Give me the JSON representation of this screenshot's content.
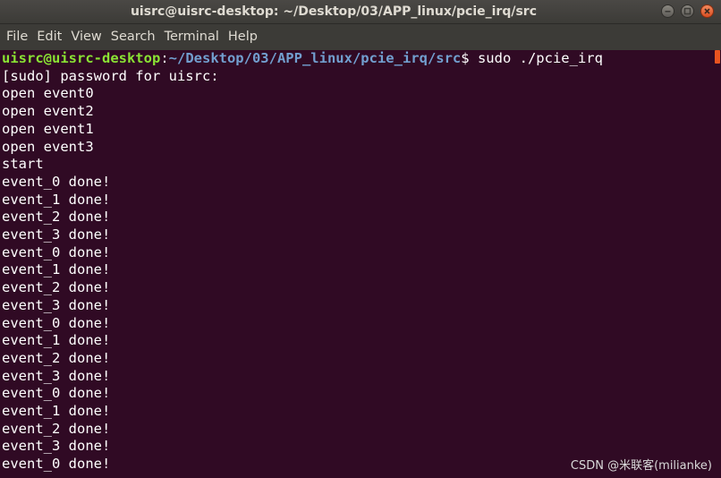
{
  "window": {
    "title": "uisrc@uisrc-desktop: ~/Desktop/03/APP_linux/pcie_irq/src"
  },
  "menu": [
    "File",
    "Edit",
    "View",
    "Search",
    "Terminal",
    "Help"
  ],
  "prompt": {
    "user_host": "uisrc@uisrc-desktop",
    "separator": ":",
    "path": "~/Desktop/03/APP_linux/pcie_irq/src",
    "symbol": "$",
    "command": " sudo ./pcie_irq"
  },
  "output_lines": [
    "[sudo] password for uisrc:",
    "open event0",
    "open event2",
    "open event1",
    "open event3",
    "start",
    "event_0 done!",
    "event_1 done!",
    "event_2 done!",
    "event_3 done!",
    "event_0 done!",
    "event_1 done!",
    "event_2 done!",
    "event_3 done!",
    "event_0 done!",
    "event_1 done!",
    "event_2 done!",
    "event_3 done!",
    "event_0 done!",
    "event_1 done!",
    "event_2 done!",
    "event_3 done!",
    "event_0 done!"
  ],
  "watermark": "CSDN @米联客(milianke)",
  "colors": {
    "terminal_bg": "#300a24",
    "prompt_user": "#8ae234",
    "prompt_path": "#729fcf",
    "scroll_accent": "#e95420"
  }
}
